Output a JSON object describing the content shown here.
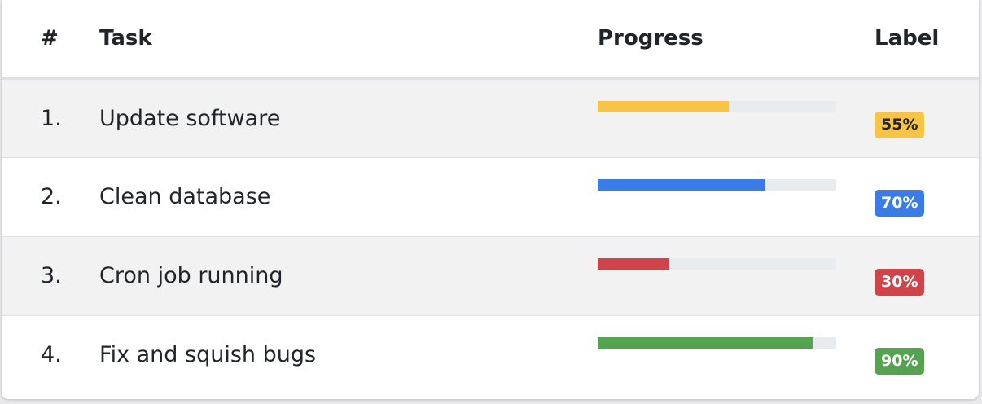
{
  "table": {
    "headers": {
      "num": "#",
      "task": "Task",
      "progress": "Progress",
      "label": "Label"
    },
    "rows": [
      {
        "num": "1.",
        "task": "Update software",
        "progress": 55,
        "label": "55%",
        "color": "#f8c446",
        "label_text_color": "#212529"
      },
      {
        "num": "2.",
        "task": "Clean database",
        "progress": 70,
        "label": "70%",
        "color": "#3b7be8",
        "label_text_color": "#ffffff"
      },
      {
        "num": "3.",
        "task": "Cron job running",
        "progress": 30,
        "label": "30%",
        "color": "#cf434b",
        "label_text_color": "#ffffff"
      },
      {
        "num": "4.",
        "task": "Fix and squish bugs",
        "progress": 90,
        "label": "90%",
        "color": "#55a351",
        "label_text_color": "#ffffff"
      }
    ]
  }
}
